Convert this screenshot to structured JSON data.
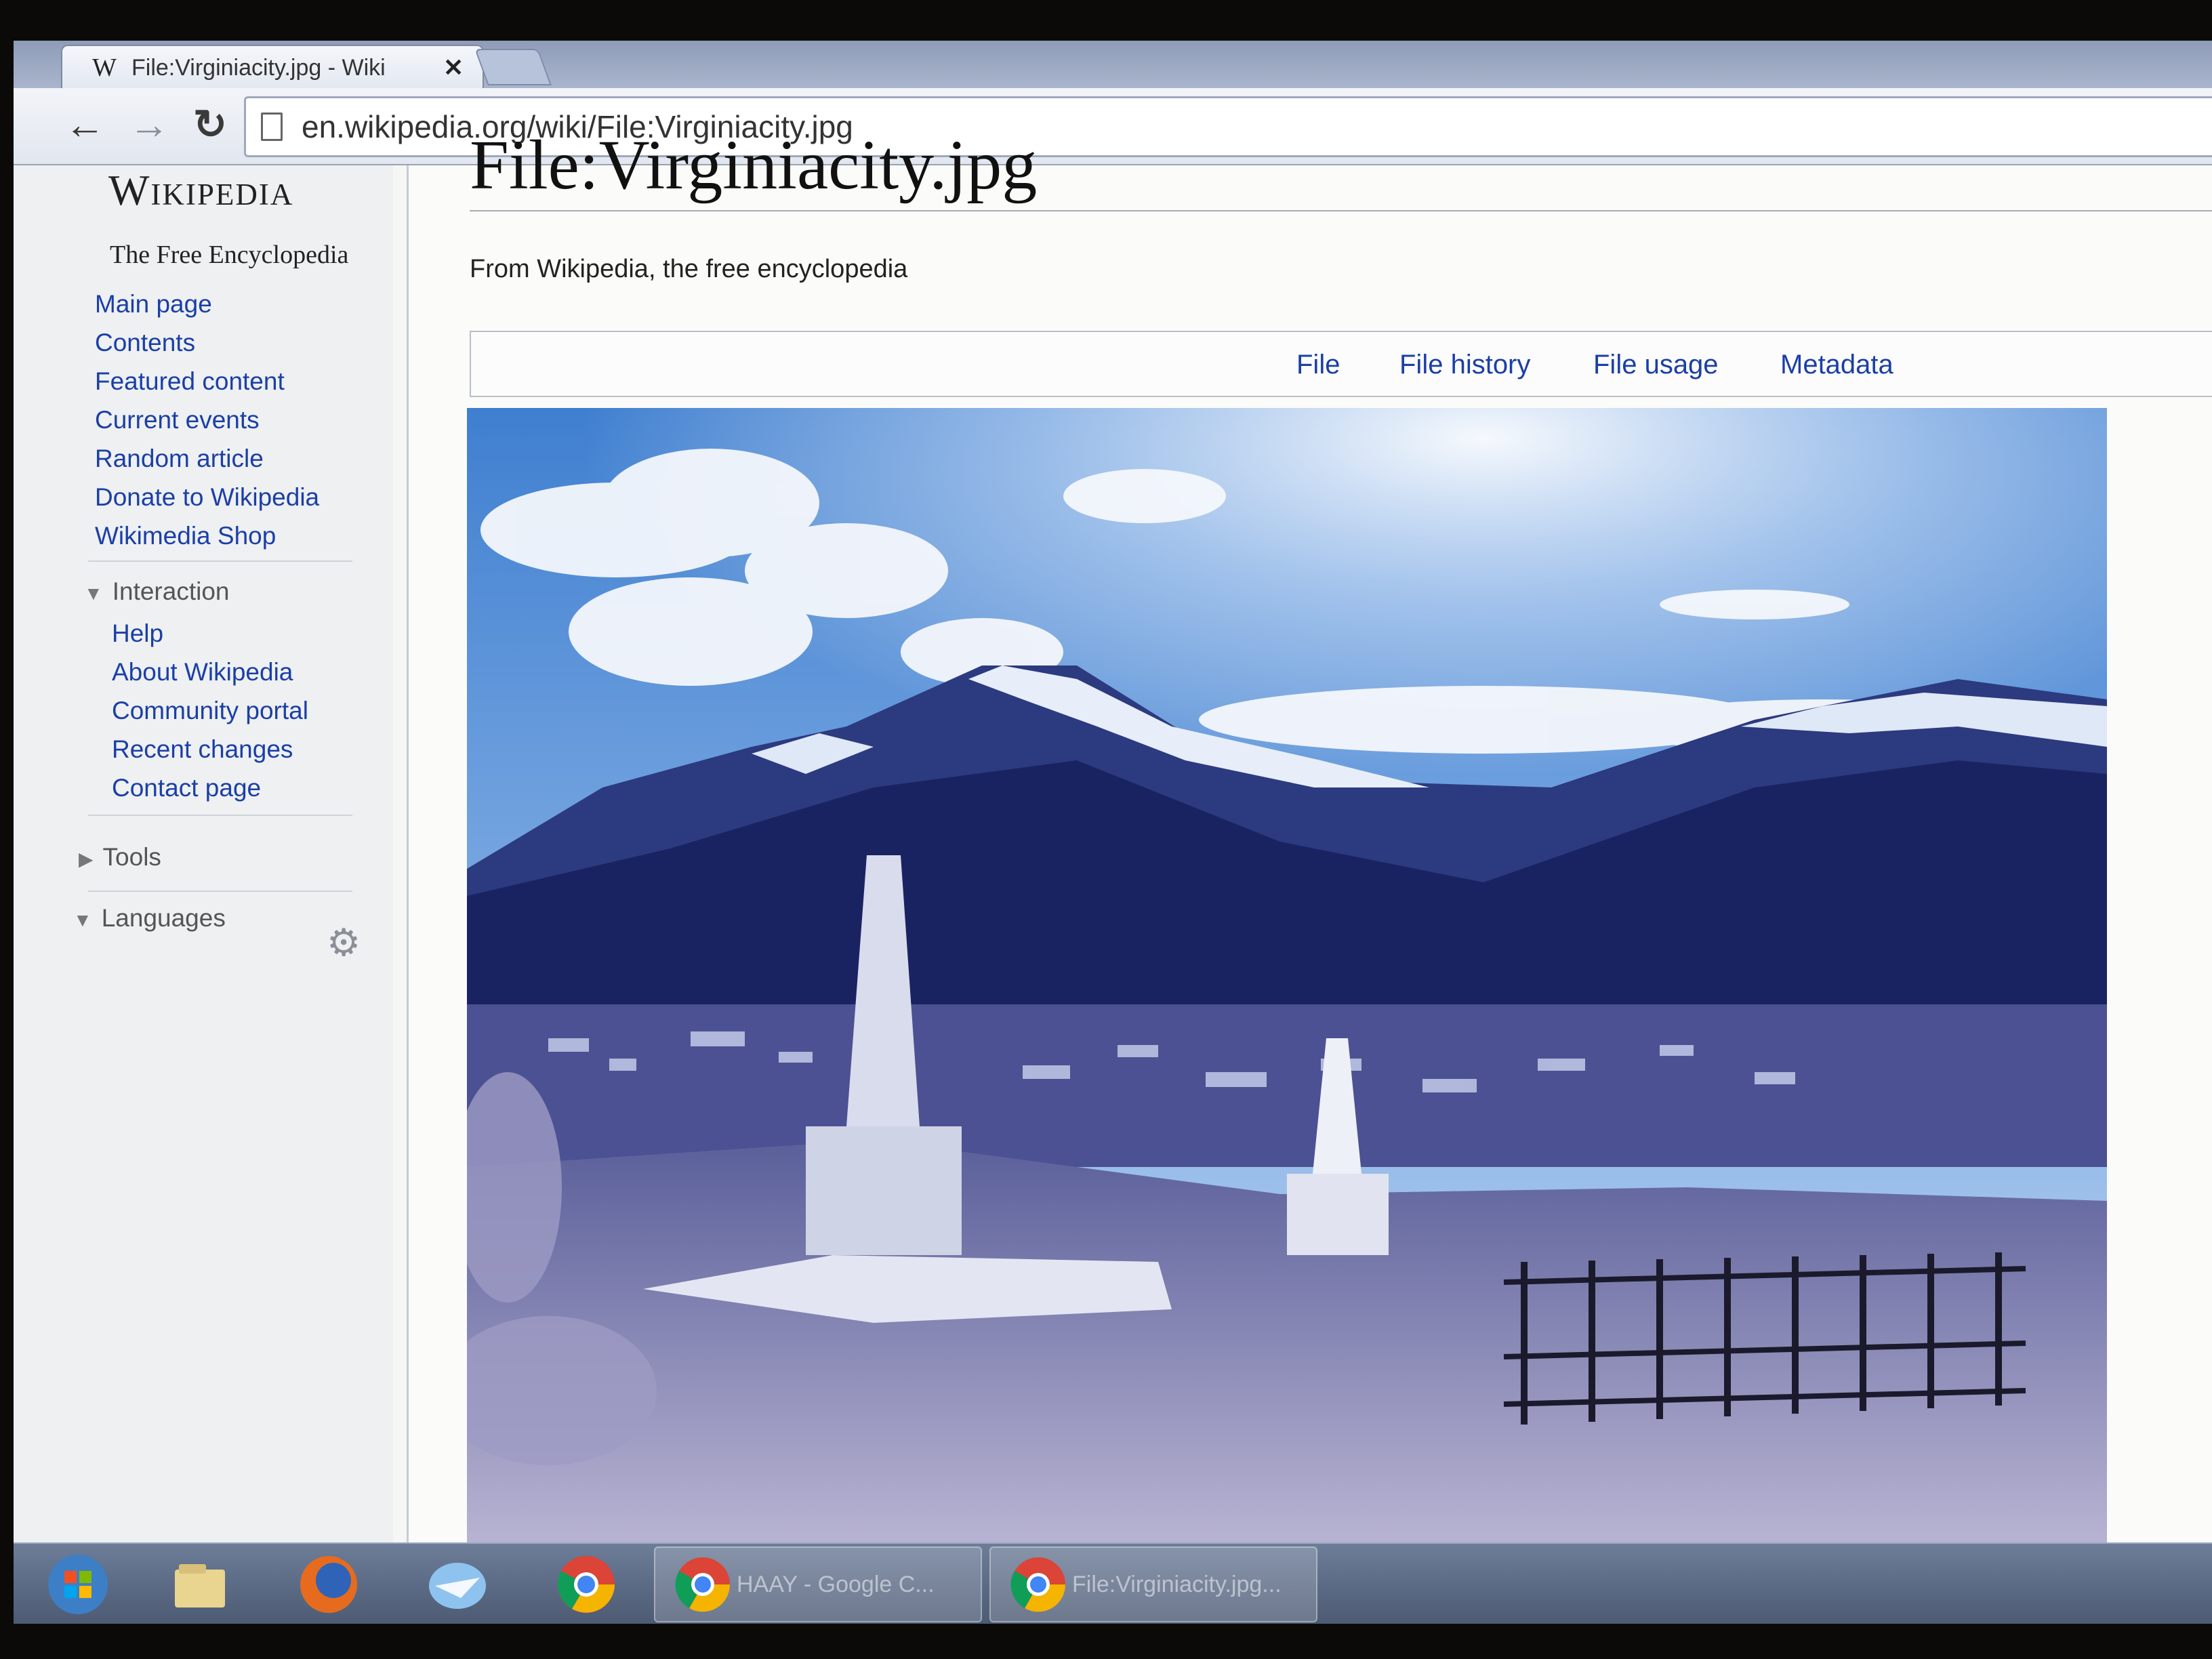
{
  "browser": {
    "tab_title": "File:Virginiacity.jpg - Wiki",
    "favicon": "W",
    "close_glyph": "✕",
    "url": "en.wikipedia.org/wiki/File:Virginiacity.jpg"
  },
  "sidebar": {
    "logo_title": "Wikipedia",
    "logo_tagline": "The Free Encyclopedia",
    "nav": [
      {
        "label": "Main page"
      },
      {
        "label": "Contents"
      },
      {
        "label": "Featured content"
      },
      {
        "label": "Current events"
      },
      {
        "label": "Random article"
      },
      {
        "label": "Donate to Wikipedia"
      },
      {
        "label": "Wikimedia Shop"
      }
    ],
    "interaction": {
      "heading": "Interaction",
      "items": [
        {
          "label": "Help"
        },
        {
          "label": "About Wikipedia"
        },
        {
          "label": "Community portal"
        },
        {
          "label": "Recent changes"
        },
        {
          "label": "Contact page"
        }
      ]
    },
    "tools": {
      "heading": "Tools"
    },
    "languages": {
      "heading": "Languages"
    }
  },
  "content": {
    "title": "File:Virginiacity.jpg",
    "tagline": "From Wikipedia, the free encyclopedia",
    "tabs": [
      {
        "label": "File"
      },
      {
        "label": "File history"
      },
      {
        "label": "File usage"
      },
      {
        "label": "Metadata"
      }
    ]
  },
  "taskbar": {
    "items": [
      {
        "icon": "windows-start-icon"
      },
      {
        "icon": "file-explorer-icon"
      },
      {
        "icon": "firefox-icon"
      },
      {
        "icon": "mail-icon"
      },
      {
        "icon": "chrome-icon"
      }
    ],
    "windows": [
      {
        "label": "HAAY - Google C..."
      },
      {
        "label": "File:Virginiacity.jpg..."
      }
    ]
  },
  "colors": {
    "link": "#1b3fa6",
    "sky": "#5a92d6",
    "mountain": "#1e2a66"
  }
}
